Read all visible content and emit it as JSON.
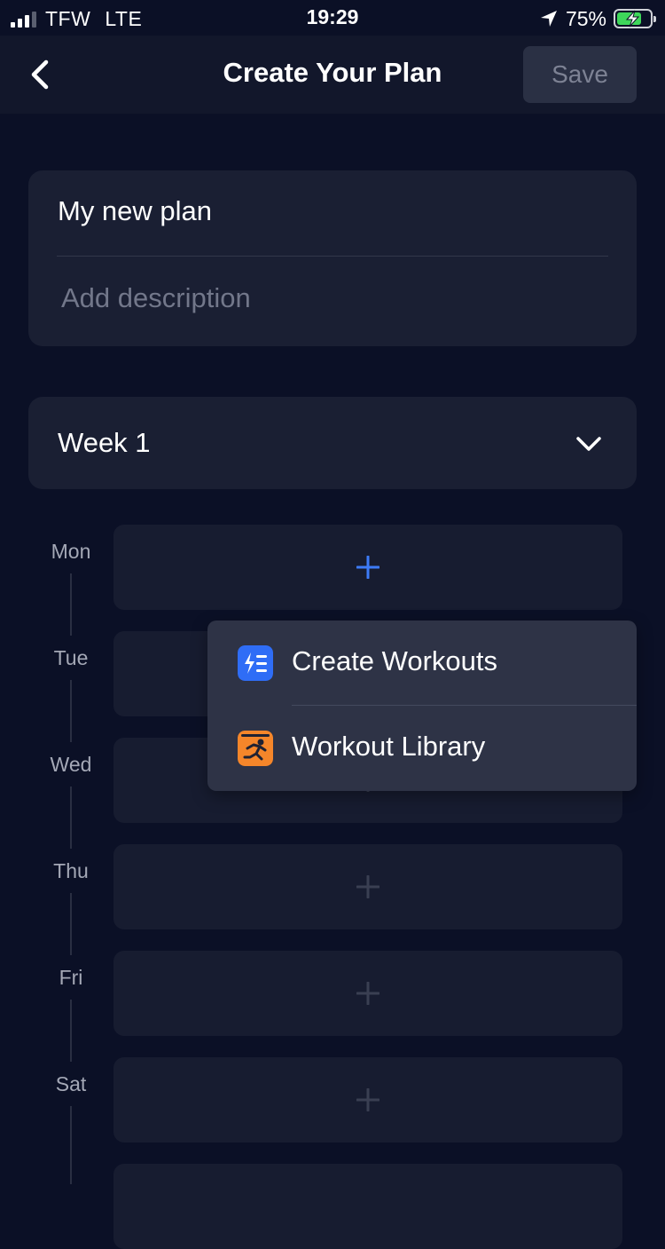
{
  "status_bar": {
    "carrier": "TFW",
    "network": "LTE",
    "time": "19:29",
    "battery": "75%",
    "battery_level": 0.75,
    "signal_bars_active": 3,
    "signal_bars_total": 4
  },
  "header": {
    "title": "Create Your Plan",
    "save_label": "Save"
  },
  "plan": {
    "name": "My new plan",
    "description_placeholder": "Add description"
  },
  "week": {
    "label": "Week 1"
  },
  "days": [
    {
      "label": "Mon",
      "active": true
    },
    {
      "label": "Tue",
      "active": false
    },
    {
      "label": "Wed",
      "active": false
    },
    {
      "label": "Thu",
      "active": false
    },
    {
      "label": "Fri",
      "active": false
    },
    {
      "label": "Sat",
      "active": false
    }
  ],
  "popup_menu": {
    "items": [
      {
        "label": "Create Workouts",
        "icon": "create-workouts-icon",
        "color": "#2f6df6"
      },
      {
        "label": "Workout Library",
        "icon": "workout-library-icon",
        "color": "#f5862a"
      }
    ]
  },
  "colors": {
    "background": "#0b1026",
    "card": "#1a1f33",
    "accent_blue": "#3d7bf7",
    "battery_green": "#3ed75a"
  }
}
